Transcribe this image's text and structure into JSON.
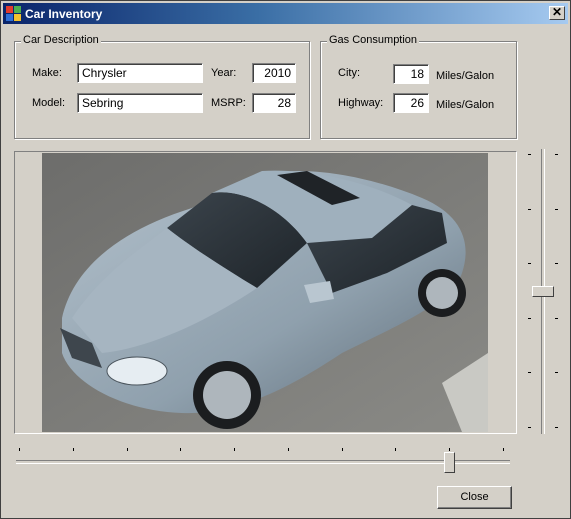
{
  "window": {
    "title": "Car Inventory",
    "close_glyph": "✕"
  },
  "car_description": {
    "group_title": "Car Description",
    "make_label": "Make:",
    "make_value": "Chrysler",
    "model_label": "Model:",
    "model_value": "Sebring",
    "year_label": "Year:",
    "year_value": "2010",
    "msrp_label": "MSRP:",
    "msrp_value": "28"
  },
  "gas_consumption": {
    "group_title": "Gas Consumption",
    "city_label": "City:",
    "city_value": "18",
    "city_unit": "Miles/Galon",
    "highway_label": "Highway:",
    "highway_value": "26",
    "highway_unit": "Miles/Galon"
  },
  "picture": {
    "subject": "silver sedan car photo"
  },
  "sliders": {
    "vertical": {
      "tick_count": 6
    },
    "horizontal": {
      "tick_count": 10
    }
  },
  "buttons": {
    "close_label": "Close"
  },
  "colors": {
    "title_start": "#0a246a",
    "title_end": "#a6caf0",
    "face": "#d4d0c8",
    "car_body": "#8fa0ad"
  }
}
